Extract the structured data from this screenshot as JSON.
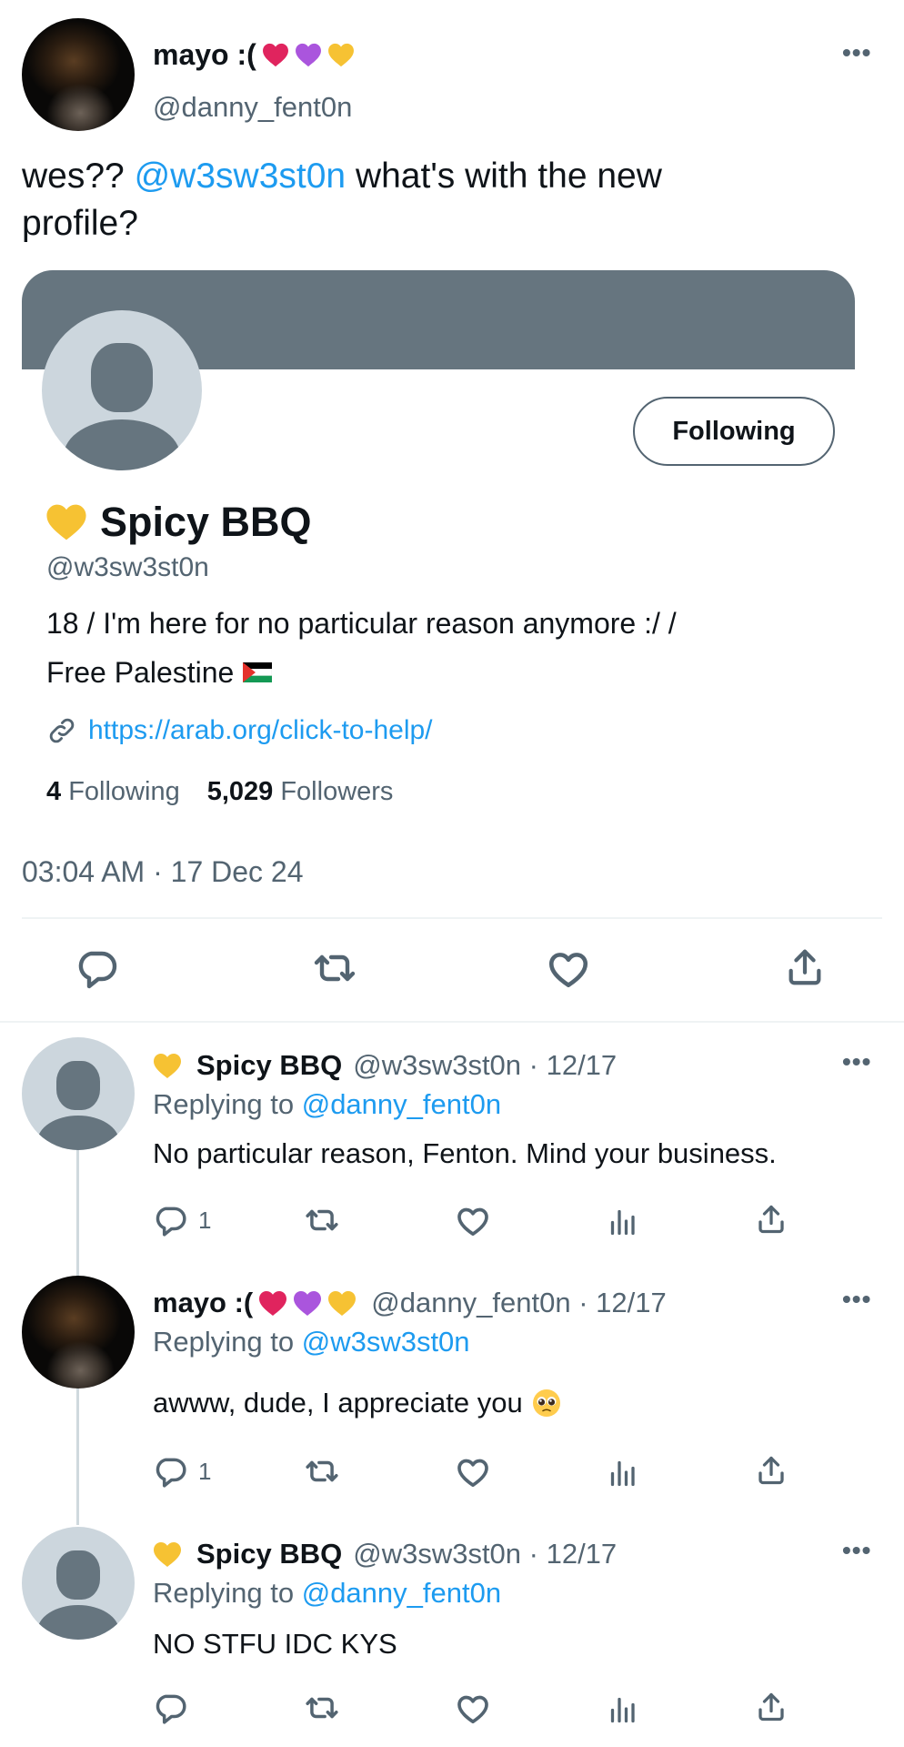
{
  "main_tweet": {
    "author_name": "mayo :(",
    "author_emojis": [
      "red-heart",
      "purple-heart",
      "yellow-heart"
    ],
    "author_handle": "@danny_fent0n",
    "more_label": "•••",
    "text_before": "wes??",
    "mention": "@w3sw3st0n",
    "text_after": "what's with the new",
    "text_line2": "profile?",
    "timestamp": "03:04 AM · 17 Dec 24"
  },
  "profile_card": {
    "banner_color": "#66757f",
    "name_emoji": "yellow-heart",
    "name": "Spicy BBQ",
    "handle": "@w3sw3st0n",
    "follow_button": "Following",
    "bio_line1": "18 / I'm here for no particular reason anymore :/ /",
    "bio_line2": "Free Palestine",
    "bio_flag": "palestine-flag",
    "link": "https://arab.org/click-to-help/",
    "following_count": "4",
    "following_label": "Following",
    "followers_count": "5,029",
    "followers_label": "Followers"
  },
  "main_actions": [
    "reply-icon",
    "retweet-icon",
    "like-icon",
    "share-icon"
  ],
  "replies": [
    {
      "name": "Spicy BBQ",
      "handle_date": "@w3sw3st0n · 12/17",
      "replying_label": "Replying to",
      "replying_to": "@danny_fent0n",
      "text": "No particular reason, Fenton. Mind your business.",
      "reply_count": "1",
      "more_label": "•••"
    },
    {
      "name": "mayo :(",
      "handle_date": "@danny_fent0n · 12/17",
      "replying_label": "Replying to",
      "replying_to": "@w3sw3st0n",
      "text": "awww, dude, I appreciate you",
      "text_emoji": "pleading-face",
      "reply_count": "1",
      "more_label": "•••"
    },
    {
      "name": "Spicy BBQ",
      "handle_date": "@w3sw3st0n · 12/17",
      "replying_label": "Replying to",
      "replying_to": "@danny_fent0n",
      "text": "NO STFU IDC KYS",
      "reply_count": "",
      "more_label": "•••"
    }
  ],
  "colors": {
    "accent": "#1d9bf0",
    "muted": "#536471",
    "divider": "#eff3f4",
    "red_heart": "#e0245e",
    "purple_heart": "#aa55dd",
    "yellow_heart": "#f6c233"
  }
}
